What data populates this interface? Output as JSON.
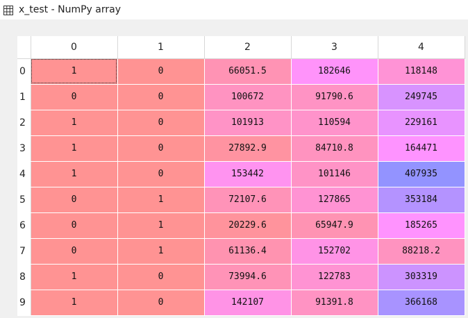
{
  "window": {
    "title": "x_test - NumPy array",
    "icon": "table-grid-icon"
  },
  "table": {
    "columns": [
      "0",
      "1",
      "2",
      "3",
      "4"
    ],
    "rows": [
      {
        "index": "0",
        "cells": [
          "1",
          "0",
          "66051.5",
          "182646",
          "118148"
        ],
        "colors": [
          "#ff9393",
          "#ff9393",
          "#ff93b4",
          "#ff93fa",
          "#ff93d6"
        ]
      },
      {
        "index": "1",
        "cells": [
          "0",
          "0",
          "100672",
          "91790.6",
          "249745"
        ],
        "colors": [
          "#ff9393",
          "#ff9393",
          "#ff93c1",
          "#ff93c4",
          "#d893ff"
        ]
      },
      {
        "index": "2",
        "cells": [
          "1",
          "0",
          "101913",
          "110594",
          "229161"
        ],
        "colors": [
          "#ff9393",
          "#ff9393",
          "#ff93c6",
          "#ff93cb",
          "#e893ff"
        ]
      },
      {
        "index": "3",
        "cells": [
          "1",
          "0",
          "27892.9",
          "84710.8",
          "164471"
        ],
        "colors": [
          "#ff9393",
          "#ff9393",
          "#ff93a1",
          "#ff93bf",
          "#fe93ff"
        ]
      },
      {
        "index": "4",
        "cells": [
          "1",
          "0",
          "153442",
          "101146",
          "407935"
        ],
        "colors": [
          "#ff9393",
          "#ff9393",
          "#ff93f0",
          "#ff93c6",
          "#9393ff"
        ]
      },
      {
        "index": "5",
        "cells": [
          "0",
          "1",
          "72107.6",
          "127865",
          "353184"
        ],
        "colors": [
          "#ff9393",
          "#ff9393",
          "#ff93b8",
          "#ff93d3",
          "#b493ff"
        ]
      },
      {
        "index": "6",
        "cells": [
          "0",
          "1",
          "20229.6",
          "65947.9",
          "185265"
        ],
        "colors": [
          "#ff9393",
          "#ff9393",
          "#ff939c",
          "#ff93b3",
          "#ff93fe"
        ]
      },
      {
        "index": "7",
        "cells": [
          "0",
          "1",
          "61136.4",
          "152702",
          "88218.2"
        ],
        "colors": [
          "#ff9393",
          "#ff9393",
          "#ff93b0",
          "#ff93e6",
          "#ff93c0"
        ]
      },
      {
        "index": "8",
        "cells": [
          "1",
          "0",
          "73994.6",
          "122783",
          "303319"
        ],
        "colors": [
          "#ff9393",
          "#ff9393",
          "#ff93b7",
          "#ff93d3",
          "#cc93ff"
        ]
      },
      {
        "index": "9",
        "cells": [
          "1",
          "0",
          "142107",
          "91391.8",
          "366168"
        ],
        "colors": [
          "#ff9393",
          "#ff9393",
          "#ff93e6",
          "#ff93c3",
          "#a893ff"
        ]
      }
    ],
    "selected_cell": "0,0"
  }
}
